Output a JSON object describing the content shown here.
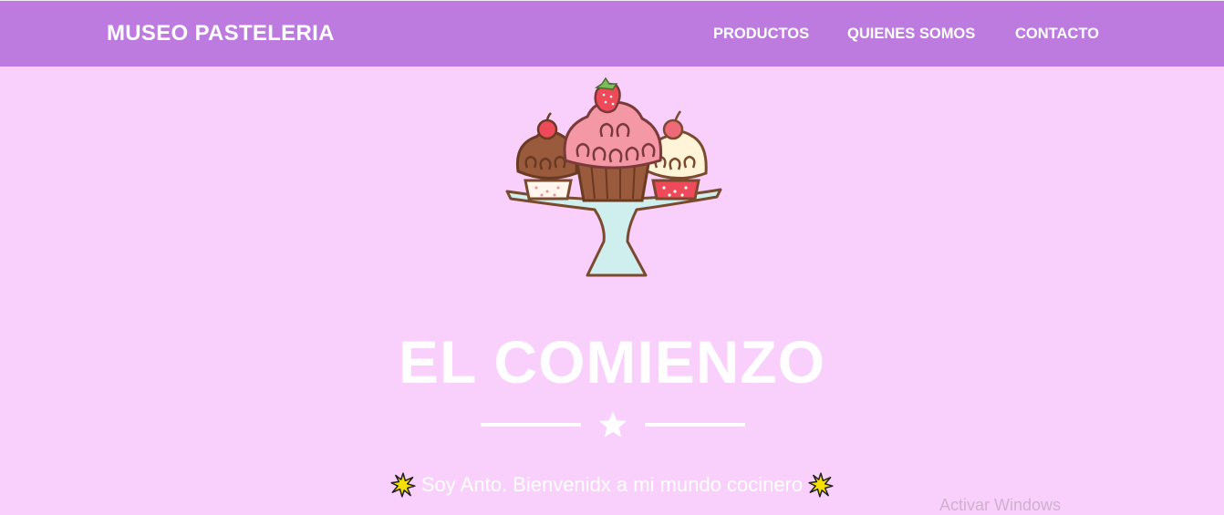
{
  "navbar": {
    "brand": "MUSEO PASTELERIA",
    "links": [
      "PRODUCTOS",
      "QUIENES SOMOS",
      "CONTACTO"
    ]
  },
  "hero": {
    "title": "EL COMIENZO",
    "subtitle": "Soy Anto. Bienvenidx a mi mundo cocinero",
    "image": "cupcakes-on-cake-stand-illustration"
  },
  "watermark": "Activar Windows",
  "colors": {
    "navbar": "#bd7be0",
    "background": "#f9d0fb",
    "text": "#ffffff",
    "sparkle": "#f5e000"
  },
  "icons": [
    "star-icon",
    "sparkle-icon"
  ]
}
